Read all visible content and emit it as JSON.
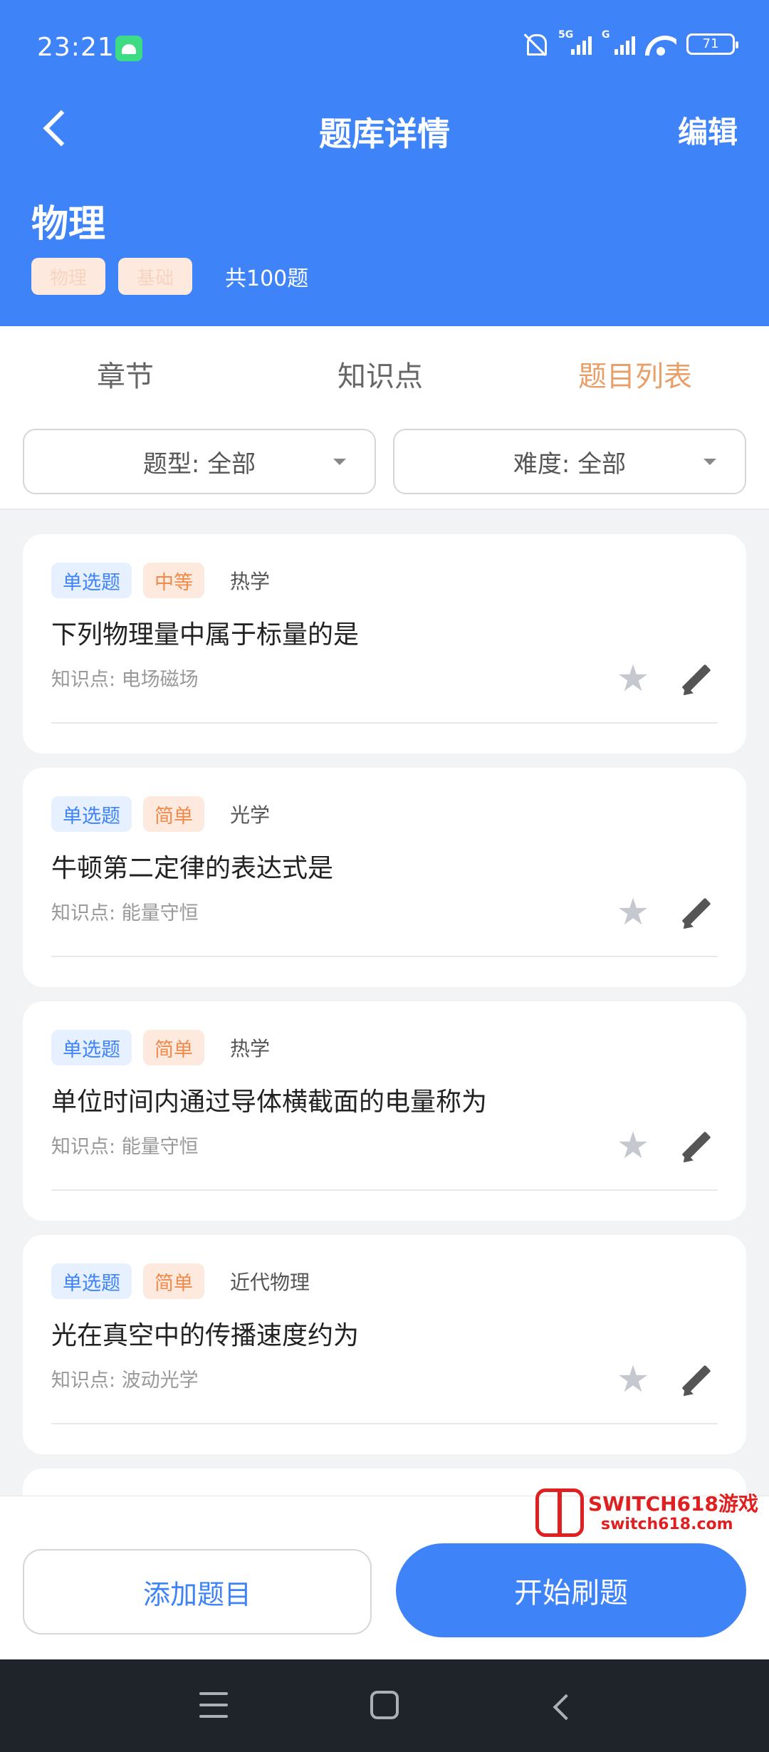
{
  "status_bar": {
    "time": "23:21",
    "battery": "71",
    "signal_tag_1": "5G",
    "signal_tag_2": "G"
  },
  "header": {
    "title": "题库详情",
    "edit_label": "编辑"
  },
  "bank": {
    "title": "物理",
    "tags": [
      "物理",
      "基础"
    ],
    "count": "共100题"
  },
  "tabs": [
    {
      "label": "章节",
      "active": false
    },
    {
      "label": "知识点",
      "active": false
    },
    {
      "label": "题目列表",
      "active": true
    }
  ],
  "filters": {
    "type": "题型: 全部",
    "difficulty": "难度: 全部"
  },
  "questions": [
    {
      "type": "单选题",
      "difficulty": "中等",
      "subject": "热学",
      "text": "下列物理量中属于标量的是",
      "knowledge": "知识点: 电场磁场"
    },
    {
      "type": "单选题",
      "difficulty": "简单",
      "subject": "光学",
      "text": "牛顿第二定律的表达式是",
      "knowledge": "知识点: 能量守恒"
    },
    {
      "type": "单选题",
      "difficulty": "简单",
      "subject": "热学",
      "text": "单位时间内通过导体横截面的电量称为",
      "knowledge": "知识点: 能量守恒"
    },
    {
      "type": "单选题",
      "difficulty": "简单",
      "subject": "近代物理",
      "text": "光在真空中的传播速度约为",
      "knowledge": "知识点: 波动光学"
    }
  ],
  "actions": {
    "add_label": "添加题目",
    "start_label": "开始刷题"
  },
  "watermark": {
    "line1": "SWITCH618游戏",
    "line2": "switch618.com"
  },
  "colors": {
    "primary": "#3f83f8",
    "accent": "#e8a06a",
    "difficulty": "#f08a4b"
  }
}
